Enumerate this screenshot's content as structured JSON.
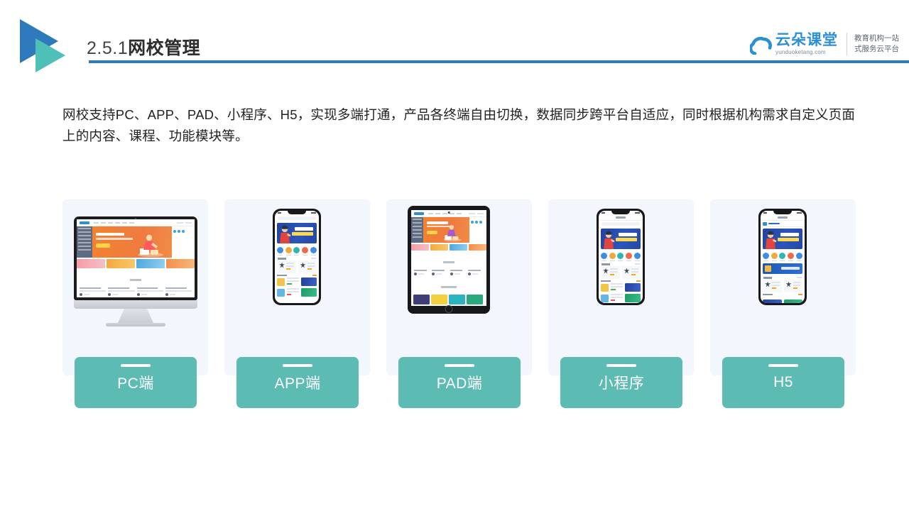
{
  "header": {
    "title_number": "2.5.1",
    "title_text": "网校管理",
    "logo_icon": "double-triangle-play-icon",
    "accent_blue": "#2f79bd",
    "accent_teal": "#4ec0b5"
  },
  "brand": {
    "icon": "cloud-icon",
    "name_cn": "云朵课堂",
    "domain": "yunduoketang.com",
    "tagline_line1": "教育机构一站",
    "tagline_line2": "式服务云平台",
    "color": "#2b8fd6"
  },
  "intro": {
    "paragraph": "网校支持PC、APP、PAD、小程序、H5，实现多端打通，产品各终端自由切换，数据同步跨平台自适应，同时根据机构需求自定义页面上的内容、课程、功能模块等。"
  },
  "cards": [
    {
      "label": "PC端",
      "device": "desktop-monitor",
      "icon": "monitor-icon"
    },
    {
      "label": "APP端",
      "device": "smartphone",
      "icon": "phone-icon"
    },
    {
      "label": "PAD端",
      "device": "tablet",
      "icon": "tablet-icon"
    },
    {
      "label": "小程序",
      "device": "smartphone",
      "icon": "phone-icon"
    },
    {
      "label": "H5",
      "device": "smartphone",
      "icon": "phone-icon"
    }
  ],
  "badge_color": "#5cbcb4",
  "card_bg": "#f3f6fc"
}
